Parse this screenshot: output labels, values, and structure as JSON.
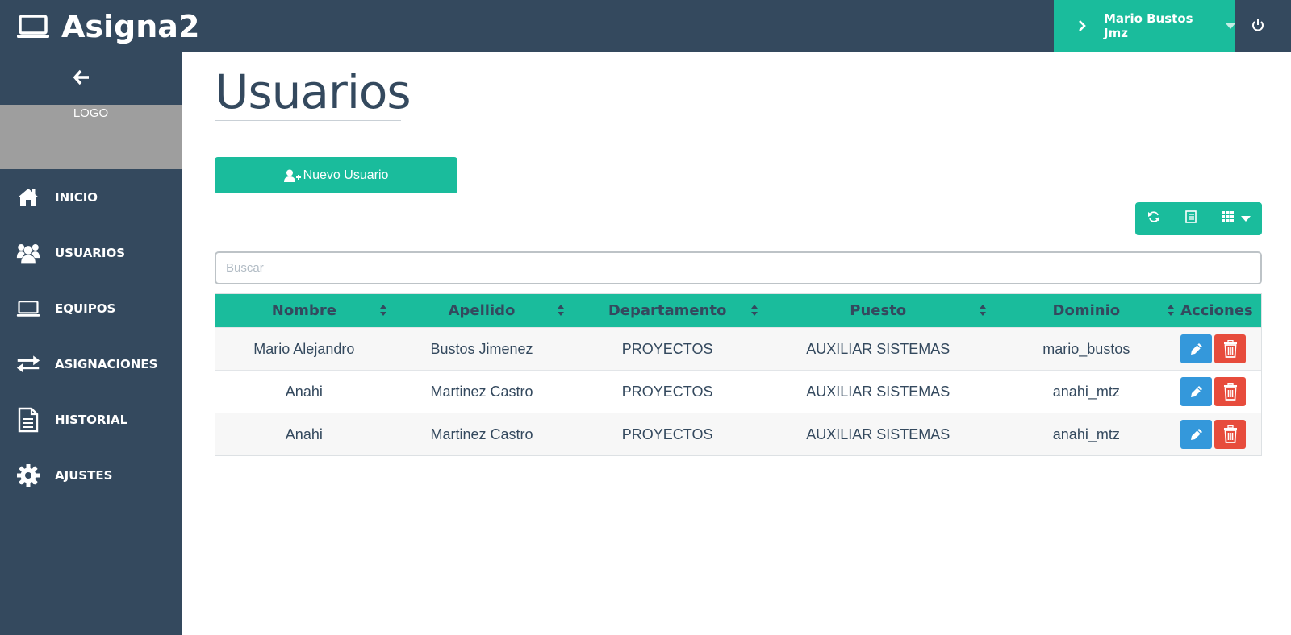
{
  "app": {
    "title": "Asigna2"
  },
  "header": {
    "user_name": "Mario Bustos Jmz"
  },
  "sidebar": {
    "logo_label": "LOGO",
    "items": [
      {
        "label": "INICIO",
        "icon": "home-icon"
      },
      {
        "label": "USUARIOS",
        "icon": "users-icon"
      },
      {
        "label": "EQUIPOS",
        "icon": "laptop-icon"
      },
      {
        "label": "ASIGNACIONES",
        "icon": "exchange-icon"
      },
      {
        "label": "HISTORIAL",
        "icon": "document-icon"
      },
      {
        "label": "AJUSTES",
        "icon": "gear-icon"
      }
    ]
  },
  "main": {
    "title": "Usuarios",
    "new_button_label": "Nuevo Usuario",
    "search_placeholder": "Buscar",
    "search_value": "",
    "columns": [
      "Nombre",
      "Apellido",
      "Departamento",
      "Puesto",
      "Dominio",
      "Acciones"
    ],
    "rows": [
      [
        "Mario Alejandro",
        "Bustos Jimenez",
        "PROYECTOS",
        "AUXILIAR SISTEMAS",
        "mario_bustos"
      ],
      [
        "Anahi",
        "Martinez Castro",
        "PROYECTOS",
        "AUXILIAR SISTEMAS",
        "anahi_mtz"
      ],
      [
        "Anahi",
        "Martinez Castro",
        "PROYECTOS",
        "AUXILIAR SISTEMAS",
        "anahi_mtz"
      ]
    ]
  },
  "colors": {
    "navy": "#34495e",
    "teal": "#1abc9c",
    "edit_blue": "#3498db",
    "delete_red": "#e74c3c",
    "logo_gray": "#9e9e9e"
  }
}
